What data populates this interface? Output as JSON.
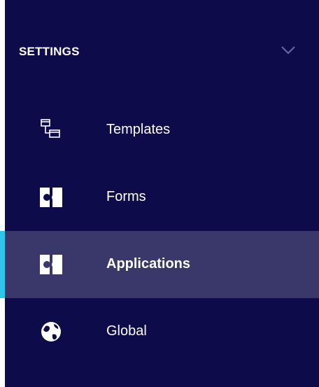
{
  "sidebar": {
    "section_title": "SETTINGS",
    "items": [
      {
        "label": "Templates",
        "icon": "templates-icon"
      },
      {
        "label": "Forms",
        "icon": "puzzle-icon"
      },
      {
        "label": "Applications",
        "icon": "puzzle-icon",
        "active": true
      },
      {
        "label": "Global",
        "icon": "globe-icon"
      }
    ]
  },
  "colors": {
    "sidebar_bg": "#0e0b4a",
    "active_bg": "#3a386a",
    "active_indicator": "#2fc4ea",
    "text": "#ffffff"
  }
}
